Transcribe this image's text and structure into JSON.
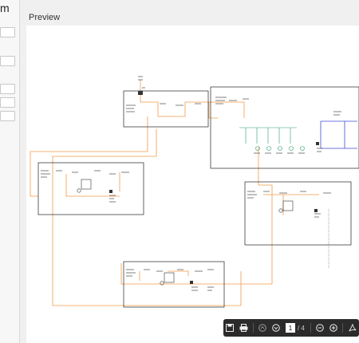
{
  "left_panel": {
    "title": "m"
  },
  "preview": {
    "label": "Preview"
  },
  "toolbar": {
    "page_value": "1",
    "page_total": "/ 4"
  }
}
